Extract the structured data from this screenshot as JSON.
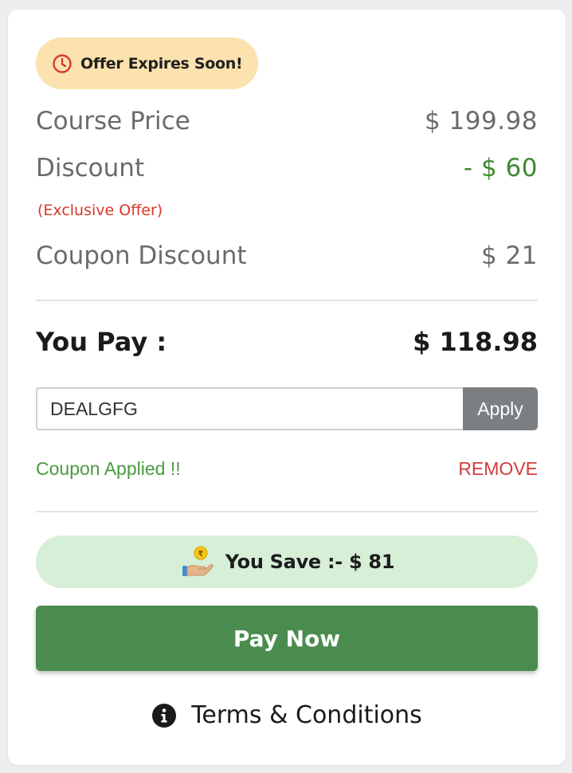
{
  "offer_badge": {
    "text": "Offer Expires Soon!",
    "icon": "clock-icon"
  },
  "summary": {
    "course_price_label": "Course Price",
    "course_price_value": "$ 199.98",
    "discount_label": "Discount",
    "discount_value": "- $ 60",
    "discount_note": "(Exclusive Offer)",
    "coupon_discount_label": "Coupon Discount",
    "coupon_discount_value": "$ 21"
  },
  "total": {
    "label": "You Pay :",
    "value": "$ 118.98"
  },
  "coupon": {
    "code": "DEALGFG",
    "apply_label": "Apply",
    "status_text": "Coupon Applied !!",
    "remove_label": "REMOVE"
  },
  "savings": {
    "text": "You Save :- $ 81",
    "icon": "hand-coin-icon"
  },
  "pay_button": {
    "label": "Pay Now"
  },
  "terms": {
    "label": "Terms & Conditions",
    "icon": "info-icon"
  },
  "colors": {
    "accent_green": "#4a8c4f",
    "badge_bg": "#fbe2ae",
    "save_bg": "#d6efd6",
    "discount_green": "#3f8a32",
    "alert_red": "#d9372a"
  }
}
